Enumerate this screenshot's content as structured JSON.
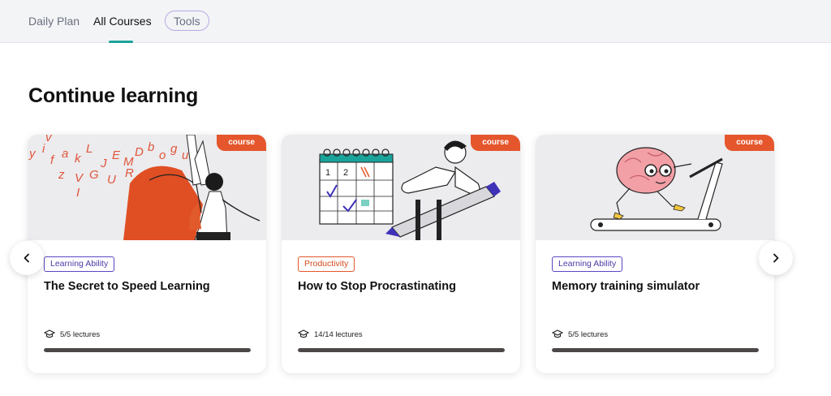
{
  "nav": {
    "tabs": [
      "Daily Plan",
      "All Courses",
      "Tools"
    ],
    "active_tab": "All Courses"
  },
  "section": {
    "title": "Continue learning"
  },
  "courses": [
    {
      "badge": "course",
      "tag": "Learning Ability",
      "title": "The Secret to Speed Learning",
      "lectures": "5/5 lectures",
      "progress": 1.0
    },
    {
      "badge": "course",
      "tag": "Productivity",
      "title": "How to Stop Procrastinating",
      "lectures": "14/14 lectures",
      "progress": 1.0
    },
    {
      "badge": "course",
      "tag": "Learning Ability",
      "title": "Memory training simulator",
      "lectures": "5/5 lectures",
      "progress": 1.0
    }
  ],
  "carousel": {
    "prev_icon": "chevron-left-icon",
    "next_icon": "chevron-right-icon"
  },
  "colors": {
    "accent_teal": "#1aa39a",
    "badge_orange": "#e5562c",
    "tag_purple": "#5b47c4",
    "progress_fill": "#4d4848"
  }
}
